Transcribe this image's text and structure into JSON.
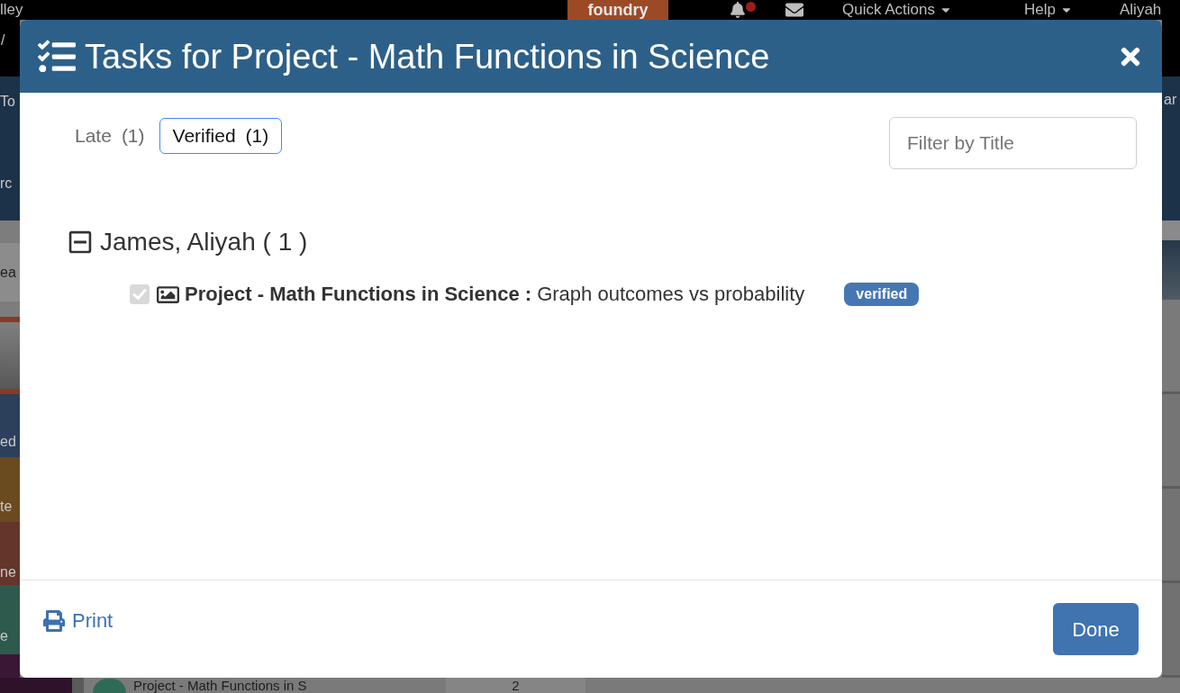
{
  "background_page": {
    "top_bar": {
      "site_name": "lley",
      "logo": "foundry",
      "notifications": {
        "unread": true
      },
      "menus": [
        {
          "label": "Quick Actions"
        },
        {
          "label": "Help"
        }
      ],
      "user": "Aliyah"
    },
    "left_edge": [
      "/",
      "To",
      "rc",
      "ea",
      "ed",
      "te",
      "ne",
      "e"
    ],
    "right_edge": [
      "ar"
    ],
    "bottom_row": {
      "title": "Project - Math Functions in S",
      "count": "2"
    }
  },
  "dialog": {
    "title": "Tasks for Project - Math Functions in Science",
    "tabs": [
      {
        "label": "Late",
        "count": "(1)",
        "selected": false
      },
      {
        "label": "Verified",
        "count": "(1)",
        "selected": true
      }
    ],
    "filter": {
      "placeholder": "Filter by Title"
    },
    "groups": [
      {
        "name": "James, Aliyah ( 1 )",
        "expanded": true,
        "tasks": [
          {
            "text": "**Project - Math Functions in Science :** Graph outcomes vs probability",
            "checked": true,
            "disabled": true,
            "badge": "verified"
          }
        ]
      }
    ],
    "footer": {
      "print": "Print",
      "done": "Done"
    }
  }
}
